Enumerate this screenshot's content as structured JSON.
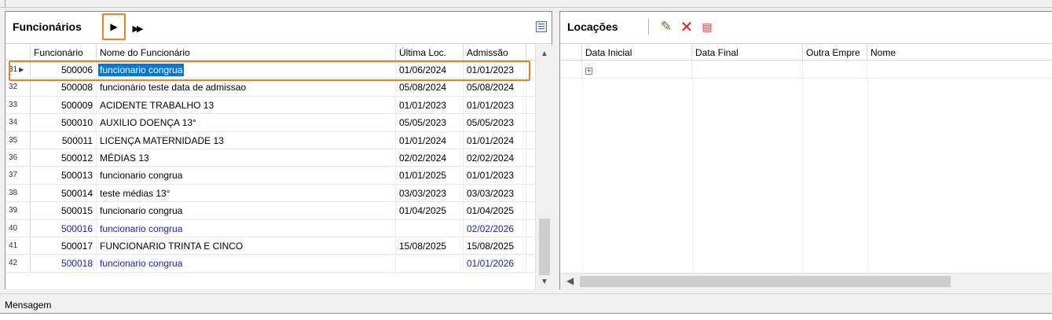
{
  "funcionarios": {
    "title": "Funcionários",
    "columns": {
      "funcionario": "Funcionário",
      "nome": "Nome do Funcionário",
      "ultima_loc": "Última Loc.",
      "admissao": "Admissão"
    },
    "rows": [
      {
        "idx": "31",
        "funcionario": "500006",
        "nome": "funcionario congrua",
        "ultima_loc": "01/06/2024",
        "admissao": "01/01/2023"
      },
      {
        "idx": "32",
        "funcionario": "500008",
        "nome": "funcionário teste data de admissao",
        "ultima_loc": "05/08/2024",
        "admissao": "05/08/2024"
      },
      {
        "idx": "33",
        "funcionario": "500009",
        "nome": "ACIDENTE TRABALHO 13",
        "ultima_loc": "01/01/2023",
        "admissao": "01/01/2023"
      },
      {
        "idx": "34",
        "funcionario": "500010",
        "nome": "AUXILIO DOENÇA 13°",
        "ultima_loc": "05/05/2023",
        "admissao": "05/05/2023"
      },
      {
        "idx": "35",
        "funcionario": "500011",
        "nome": "LICENÇA MATERNIDADE 13",
        "ultima_loc": "01/01/2024",
        "admissao": "01/01/2024"
      },
      {
        "idx": "36",
        "funcionario": "500012",
        "nome": "MÉDIAS 13",
        "ultima_loc": "02/02/2024",
        "admissao": "02/02/2024"
      },
      {
        "idx": "37",
        "funcionario": "500013",
        "nome": "funcionario congrua",
        "ultima_loc": "01/01/2025",
        "admissao": "01/01/2023"
      },
      {
        "idx": "38",
        "funcionario": "500014",
        "nome": "teste médias 13°",
        "ultima_loc": "03/03/2023",
        "admissao": "03/03/2023"
      },
      {
        "idx": "39",
        "funcionario": "500015",
        "nome": "funcionario congrua",
        "ultima_loc": "01/04/2025",
        "admissao": "01/04/2025"
      },
      {
        "idx": "40",
        "funcionario": "500016",
        "nome": "funcionario congrua",
        "ultima_loc": "",
        "admissao": "02/02/2026"
      },
      {
        "idx": "41",
        "funcionario": "500017",
        "nome": "FUNCIONARIO TRINTA E CINCO",
        "ultima_loc": "15/08/2025",
        "admissao": "15/08/2025"
      },
      {
        "idx": "42",
        "funcionario": "500018",
        "nome": "funcionario congrua",
        "ultima_loc": "",
        "admissao": "01/01/2026"
      }
    ]
  },
  "locacoes": {
    "title": "Locações",
    "columns": {
      "data_inicial": "Data Inicial",
      "data_final": "Data Final",
      "outra_empresa": "Outra Empre",
      "nome": "Nome"
    }
  },
  "footer": {
    "mensagem_label": "Mensagem"
  },
  "colors": {
    "highlight_outline": "#f07d2c",
    "selection": "#0078d7",
    "future_row_text": "#1a1acc"
  }
}
